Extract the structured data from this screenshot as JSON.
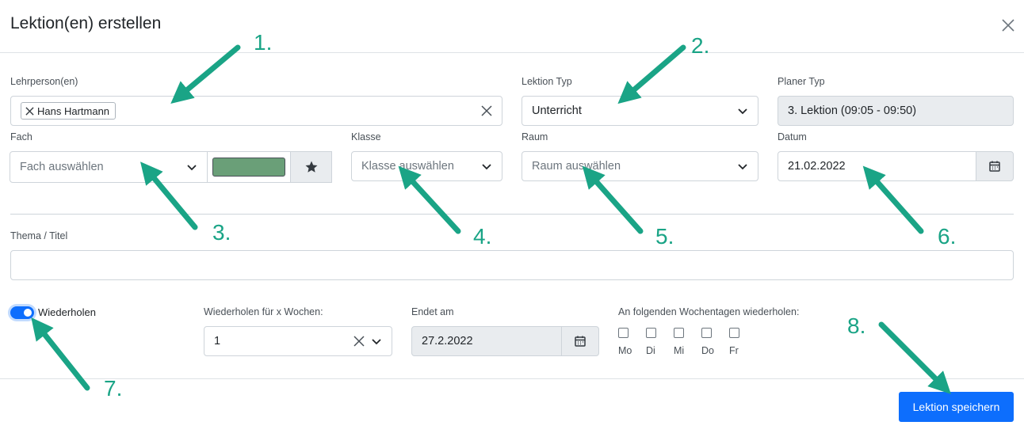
{
  "dialog": {
    "title": "Lektion(en) erstellen"
  },
  "lehrperson": {
    "label": "Lehrperson(en)",
    "tag": "Hans Hartmann"
  },
  "lektion_typ": {
    "label": "Lektion Typ",
    "value": "Unterricht"
  },
  "planer_typ": {
    "label": "Planer Typ",
    "value": "3. Lektion (09:05 - 09:50)"
  },
  "fach": {
    "label": "Fach",
    "placeholder": "Fach auswählen",
    "color": "#6a9f78"
  },
  "klasse": {
    "label": "Klasse",
    "placeholder": "Klasse auswählen"
  },
  "raum": {
    "label": "Raum",
    "placeholder": "Raum auswählen"
  },
  "datum": {
    "label": "Datum",
    "value": "21.02.2022"
  },
  "thema": {
    "label": "Thema / Titel",
    "value": ""
  },
  "wiederholen": {
    "label": "Wiederholen",
    "weeks_label": "Wiederholen für x Wochen:",
    "weeks_value": "1",
    "endet_label": "Endet am",
    "endet_value": "27.2.2022",
    "weekdays_label": "An folgenden Wochentagen wiederholen:",
    "weekdays": [
      "Mo",
      "Di",
      "Mi",
      "Do",
      "Fr"
    ]
  },
  "save_button": "Lektion speichern",
  "annotations": [
    "1.",
    "2.",
    "3.",
    "4.",
    "5.",
    "6.",
    "7.",
    "8."
  ],
  "colors": {
    "accent": "#0d6efd",
    "annotation": "#1aa486"
  }
}
